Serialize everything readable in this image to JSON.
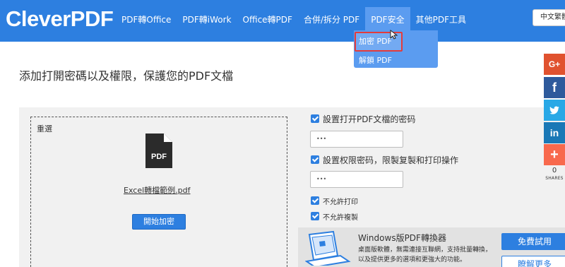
{
  "header": {
    "logo": "CleverPDF",
    "nav": [
      {
        "label": "PDF轉Office"
      },
      {
        "label": "PDF轉iWork"
      },
      {
        "label": "Office轉PDF"
      },
      {
        "label": "合併/拆分 PDF"
      },
      {
        "label": "PDF安全"
      },
      {
        "label": "其他PDF工具"
      }
    ],
    "language": "中文繁體"
  },
  "dropdown": {
    "items": [
      {
        "label": "加密 PDF"
      },
      {
        "label": "解鎖 PDF"
      }
    ]
  },
  "page_title": "添加打開密碼以及權限，保護您的PDF文檔",
  "upload": {
    "reset_label": "重選",
    "file_icon_text": "PDF",
    "file_name": "Excel轉檔範例.pdf",
    "start_button": "開始加密"
  },
  "options": {
    "open_password_label": "設置打开PDF文檔的密码",
    "open_password_value": "•••",
    "permission_password_label": "設置权限密码，限製复製和打印操作",
    "permission_password_value": "•••",
    "no_print_label": "不允許打印",
    "no_copy_label": "不允許複製"
  },
  "promo": {
    "title": "Windows版PDF轉換器",
    "description": "桌面版軟體，無需連接互聯網，支持批量轉換，以及提供更多的選項和更強大的功能。",
    "trial_button": "免費試用",
    "more_button": "瞭解更多"
  },
  "social": {
    "gplus": "G+",
    "facebook": "f",
    "twitter": "t",
    "linkedin": "in",
    "more": "+",
    "count": "0",
    "shares_label": "SHARES"
  },
  "colors": {
    "brand_blue": "#2d7fe0",
    "dropdown_blue": "#5b9cf0",
    "highlight_red": "#e33b3b",
    "panel_gray": "#f1f1f1"
  }
}
